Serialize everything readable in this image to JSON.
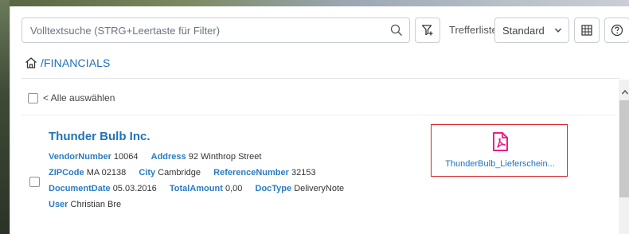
{
  "search": {
    "placeholder": "Volltextsuche (STRG+Leertaste für Filter)"
  },
  "toolbar": {
    "hits_label": "Trefferliste:",
    "hits_selected": "Standard"
  },
  "breadcrumb": {
    "path": "/FINANCIALS"
  },
  "list": {
    "select_all_label": "< Alle auswählen"
  },
  "result": {
    "title": "Thunder Bulb Inc.",
    "fields": {
      "vendor_number_key": "VendorNumber",
      "vendor_number_val": "10064",
      "address_key": "Address",
      "address_val": "92 Winthrop Street",
      "zipcode_key": "ZIPCode",
      "zipcode_val": "MA 02138",
      "city_key": "City",
      "city_val": "Cambridge",
      "reference_number_key": "ReferenceNumber",
      "reference_number_val": "32153",
      "document_date_key": "DocumentDate",
      "document_date_val": "05.03.2016",
      "total_amount_key": "TotalAmount",
      "total_amount_val": "0,00",
      "doctype_key": "DocType",
      "doctype_val": "DeliveryNote",
      "user_key": "User",
      "user_val": "Christian Bre"
    },
    "attachment": {
      "name": "ThunderBulb_Lieferschein..."
    }
  },
  "colors": {
    "accent": "#1e73b8",
    "pdf": "#e8208a",
    "highlight_border": "#d9262c"
  },
  "icons": [
    "search-icon",
    "filter-icon",
    "chevron-down-icon",
    "grid-icon",
    "help-icon",
    "home-icon",
    "pdf-icon",
    "scroll-up-icon"
  ]
}
